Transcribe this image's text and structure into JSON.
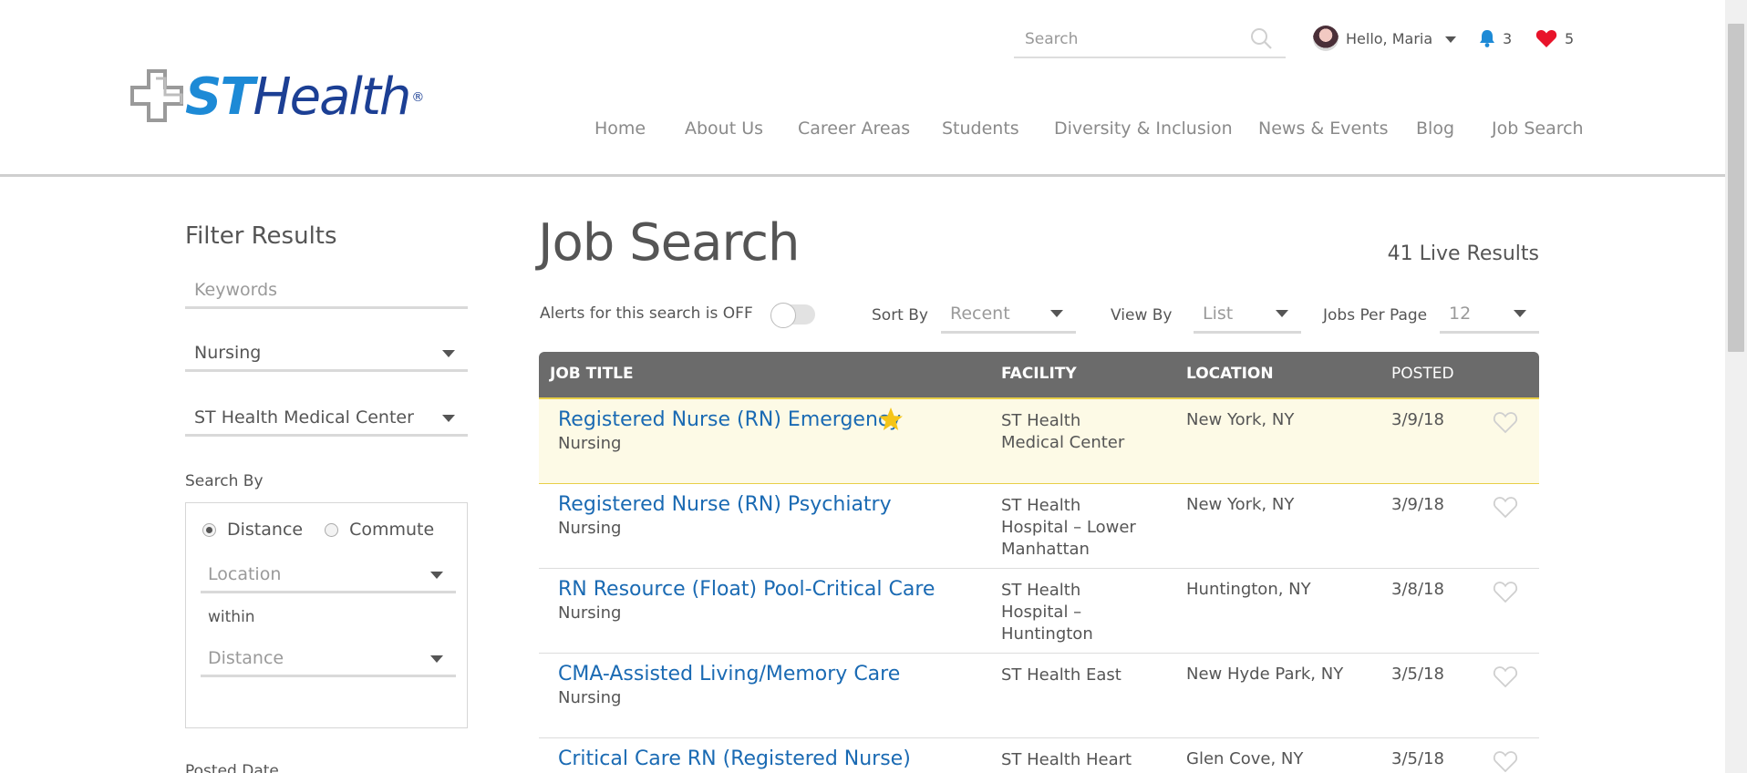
{
  "header": {
    "logo": {
      "st": "ST",
      "health": "Health",
      "reg": "®"
    },
    "search": {
      "placeholder": "Search",
      "value": ""
    },
    "user": {
      "greeting": "Hello, Maria"
    },
    "notifications": {
      "count": "3"
    },
    "favorites": {
      "count": "5"
    },
    "nav": [
      {
        "label": "Home"
      },
      {
        "label": "About Us"
      },
      {
        "label": "Career Areas"
      },
      {
        "label": "Students"
      },
      {
        "label": "Diversity & Inclusion"
      },
      {
        "label": "News & Events"
      },
      {
        "label": "Blog"
      },
      {
        "label": "Job Search"
      }
    ]
  },
  "sidebar": {
    "title": "Filter Results",
    "keywords_placeholder": "Keywords",
    "category": "Nursing",
    "facility": "ST Health Medical Center",
    "search_by_label": "Search By",
    "radio_distance": "Distance",
    "radio_commute": "Commute",
    "location_placeholder": "Location",
    "within_label": "within",
    "distance_placeholder": "Distance",
    "posted_date_label": "Posted Date"
  },
  "main": {
    "title": "Job Search",
    "results": "41 Live Results",
    "alerts_label": "Alerts for this search is OFF",
    "sort_label": "Sort By",
    "sort_value": "Recent",
    "view_label": "View By",
    "view_value": "List",
    "per_page_label": "Jobs Per Page",
    "per_page_value": "12",
    "columns": {
      "title": "JOB TITLE",
      "facility": "FACILITY",
      "location": "LOCATION",
      "posted": "POSTED"
    },
    "jobs": [
      {
        "title": "Registered Nurse (RN) Emergency",
        "category": "Nursing",
        "facility": "ST Health Medical Center",
        "location": "New York, NY",
        "posted": "3/9/18"
      },
      {
        "title": "Registered Nurse (RN) Psychiatry",
        "category": "Nursing",
        "facility": "ST Health Hospital – Lower Manhattan",
        "location": "New York, NY",
        "posted": "3/9/18"
      },
      {
        "title": "RN Resource (Float) Pool-Critical Care",
        "category": "Nursing",
        "facility": "ST Health Hospital – Huntington",
        "location": "Huntington, NY",
        "posted": "3/8/18"
      },
      {
        "title": "CMA-Assisted Living/Memory Care",
        "category": "Nursing",
        "facility": "ST Health East",
        "location": "New Hyde Park, NY",
        "posted": "3/5/18"
      },
      {
        "title": "Critical Care RN (Registered Nurse)",
        "category": "",
        "facility": "ST Health Heart",
        "location": "Glen Cove, NY",
        "posted": "3/5/18"
      }
    ]
  },
  "colors": {
    "link_blue": "#1a6ab3",
    "header_gray": "#6b6b6b",
    "featured_bg": "#fdfae6",
    "star_gold": "#f5c518",
    "heart_red": "#e8132a",
    "bell_blue": "#1d8ad6"
  },
  "icons": {
    "search": "search-icon",
    "bell": "bell-icon",
    "favorites": "heart-icon",
    "caret": "chevron-down-icon",
    "featured": "star-icon",
    "save": "heart-outline-icon"
  }
}
